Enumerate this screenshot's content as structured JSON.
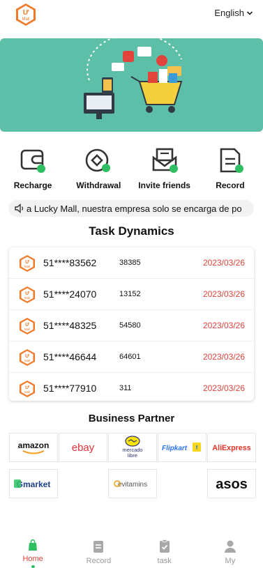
{
  "header": {
    "language": "English"
  },
  "actions": [
    {
      "label": "Recharge"
    },
    {
      "label": "Withdrawal"
    },
    {
      "label": "Invite friends"
    },
    {
      "label": "Record"
    }
  ],
  "notice": {
    "text": "a Lucky Mall, nuestra empresa solo se encarga de po"
  },
  "task_dynamics": {
    "title": "Task Dynamics",
    "rows": [
      {
        "account": "51****83562",
        "amount": "38385",
        "date": "2023/03/26"
      },
      {
        "account": "51****24070",
        "amount": "13152",
        "date": "2023/03/26"
      },
      {
        "account": "51****48325",
        "amount": "54580",
        "date": "2023/03/26"
      },
      {
        "account": "51****46644",
        "amount": "64601",
        "date": "2023/03/26"
      },
      {
        "account": "51****77910",
        "amount": "311",
        "date": "2023/03/26"
      }
    ]
  },
  "partners": {
    "title": "Business Partner",
    "logos": [
      "amazon",
      "ebay",
      "mercado libre",
      "Flipkart",
      "AliExpress",
      "Gmarket",
      "",
      "evitamins",
      "",
      "asos"
    ]
  },
  "tabbar": {
    "items": [
      {
        "label": "Home",
        "active": true
      },
      {
        "label": "Record",
        "active": false
      },
      {
        "label": "task",
        "active": false
      },
      {
        "label": "My",
        "active": false
      }
    ]
  },
  "colors": {
    "accent": "#e0443b",
    "banner": "#5dbfa8",
    "icon_green": "#2ebf63",
    "logo_orange": "#f07a2a"
  }
}
